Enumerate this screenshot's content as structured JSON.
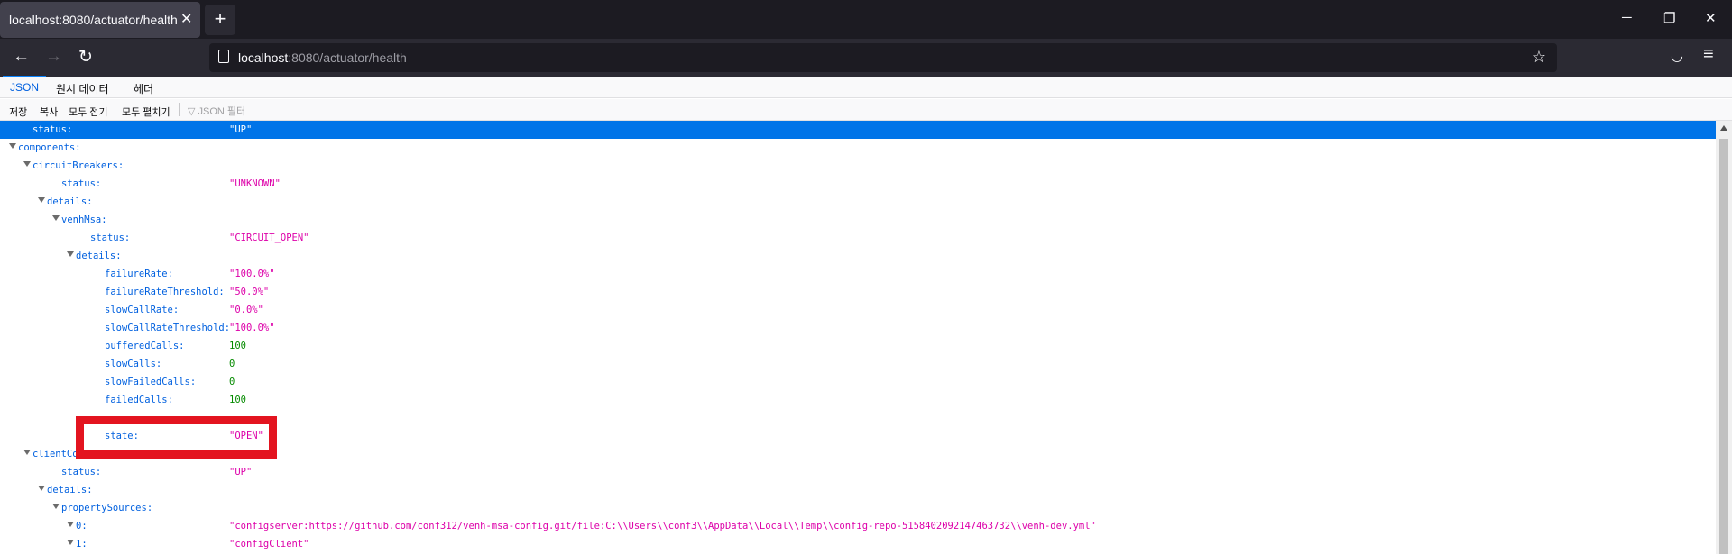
{
  "browser": {
    "tab_title": "localhost:8080/actuator/health",
    "tab_close": "✕",
    "new_tab": "+",
    "url_host": "localhost",
    "url_rest": ":8080/actuator/health",
    "minimize": "─",
    "restore": "❐",
    "close": "✕",
    "back": "←",
    "forward": "→",
    "reload": "↻",
    "star": "☆",
    "pocket": "◡",
    "menu": "≡"
  },
  "viewer": {
    "tabs": [
      "JSON",
      "원시 데이터",
      "헤더"
    ],
    "toolbar": [
      "저장",
      "복사",
      "모두 접기",
      "모두 펼치기"
    ],
    "filter_placeholder": "JSON 필터",
    "filter_icon": "▽"
  },
  "tree": [
    {
      "key": "status:",
      "value": "\"UP\"",
      "type": "str",
      "depth": 1,
      "twisty": false,
      "selected": true
    },
    {
      "key": "components:",
      "value": "",
      "type": "obj",
      "depth": 0,
      "twisty": true
    },
    {
      "key": "circuitBreakers:",
      "value": "",
      "type": "obj",
      "depth": 1,
      "twisty": true
    },
    {
      "key": "status:",
      "value": "\"UNKNOWN\"",
      "type": "str",
      "depth": 3,
      "twisty": false
    },
    {
      "key": "details:",
      "value": "",
      "type": "obj",
      "depth": 2,
      "twisty": true
    },
    {
      "key": "venhMsa:",
      "value": "",
      "type": "obj",
      "depth": 3,
      "twisty": true
    },
    {
      "key": "status:",
      "value": "\"CIRCUIT_OPEN\"",
      "type": "str",
      "depth": 5,
      "twisty": false
    },
    {
      "key": "details:",
      "value": "",
      "type": "obj",
      "depth": 4,
      "twisty": true
    },
    {
      "key": "failureRate:",
      "value": "\"100.0%\"",
      "type": "str",
      "depth": 6,
      "twisty": false
    },
    {
      "key": "failureRateThreshold:",
      "value": "\"50.0%\"",
      "type": "str",
      "depth": 6,
      "twisty": false
    },
    {
      "key": "slowCallRate:",
      "value": "\"0.0%\"",
      "type": "str",
      "depth": 6,
      "twisty": false
    },
    {
      "key": "slowCallRateThreshold:",
      "value": "\"100.0%\"",
      "type": "str",
      "depth": 6,
      "twisty": false
    },
    {
      "key": "bufferedCalls:",
      "value": "100",
      "type": "num",
      "depth": 6,
      "twisty": false
    },
    {
      "key": "slowCalls:",
      "value": "0",
      "type": "num",
      "depth": 6,
      "twisty": false
    },
    {
      "key": "slowFailedCalls:",
      "value": "0",
      "type": "num",
      "depth": 6,
      "twisty": false
    },
    {
      "key": "failedCalls:",
      "value": "100",
      "type": "num",
      "depth": 6,
      "twisty": false
    },
    {
      "key": "",
      "value": "",
      "type": "gap",
      "depth": 0,
      "twisty": false
    },
    {
      "key": "state:",
      "value": "\"OPEN\"",
      "type": "str",
      "depth": 6,
      "twisty": false
    },
    {
      "key": "clientConfig:",
      "value": "",
      "type": "obj",
      "depth": 1,
      "twisty": true
    },
    {
      "key": "status:",
      "value": "\"UP\"",
      "type": "str",
      "depth": 3,
      "twisty": false
    },
    {
      "key": "details:",
      "value": "",
      "type": "obj",
      "depth": 2,
      "twisty": true
    },
    {
      "key": "propertySources:",
      "value": "",
      "type": "obj",
      "depth": 3,
      "twisty": true
    },
    {
      "key": "0:",
      "value": "\"configserver:https://github.com/conf312/venh-msa-config.git/file:C:\\\\Users\\\\conf3\\\\AppData\\\\Local\\\\Temp\\\\config-repo-5158402092147463732\\\\venh-dev.yml\"",
      "type": "str",
      "depth": 4,
      "twisty": true
    },
    {
      "key": "1:",
      "value": "\"configClient\"",
      "type": "str",
      "depth": 4,
      "twisty": true
    }
  ]
}
